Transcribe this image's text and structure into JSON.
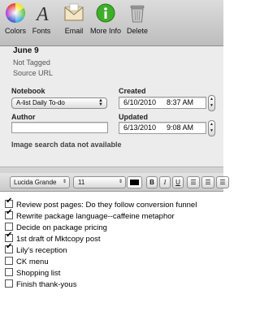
{
  "toolbar": {
    "colors_label": "Colors",
    "fonts_label": "Fonts",
    "email_label": "Email",
    "more_info_label": "More Info",
    "delete_label": "Delete"
  },
  "note": {
    "title": "June 9",
    "tags": "Not Tagged",
    "source": "Source URL"
  },
  "fields": {
    "notebook_label": "Notebook",
    "notebook_value": "A-list Daily To-do",
    "created_label": "Created",
    "created_date": "6/10/2010",
    "created_time": "8:37 AM",
    "author_label": "Author",
    "author_value": "",
    "updated_label": "Updated",
    "updated_date": "6/13/2010",
    "updated_time": "9:08 AM",
    "image_search": "Image search data not available"
  },
  "format": {
    "font": "Lucida Grande",
    "size": "11",
    "bold": "B",
    "italic": "I",
    "underline": "U"
  },
  "todos": [
    {
      "text": "Review post pages: Do they follow conversion funnel",
      "checked": true
    },
    {
      "text": "Rewrite package language--caffeine metaphor",
      "checked": true
    },
    {
      "text": "Decide on package pricing",
      "checked": false
    },
    {
      "text": "1st draft of Mktcopy post",
      "checked": true
    },
    {
      "text": "Lily's reception",
      "checked": true
    },
    {
      "text": "CK menu",
      "checked": false
    },
    {
      "text": "Shopping list",
      "checked": false
    },
    {
      "text": "Finish thank-yous",
      "checked": false
    }
  ]
}
